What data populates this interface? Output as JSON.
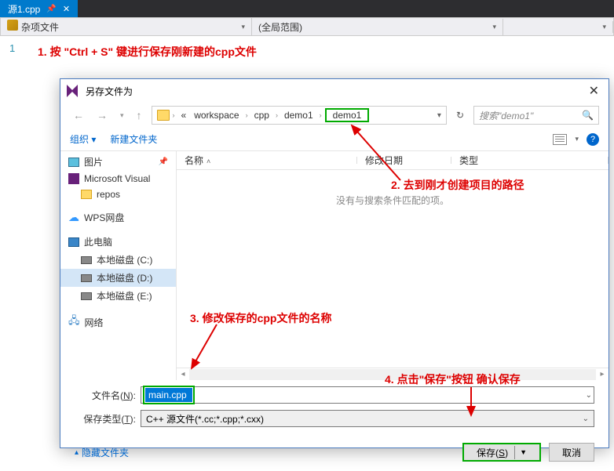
{
  "editor": {
    "tab_name": "源1.cpp",
    "misc_dropdown": "杂项文件",
    "scope_dropdown": "(全局范围)",
    "line_no": "1"
  },
  "annotations": {
    "a1": "1. 按 \"Ctrl + S\" 键进行保存刚新建的cpp文件",
    "a2": "2. 去到刚才创建项目的路径",
    "a3": "3. 修改保存的cpp文件的名称",
    "a4": "4. 点击\"保存\"按钮 确认保存"
  },
  "dialog": {
    "title": "另存文件为",
    "breadcrumb": {
      "prefix": "«",
      "items": [
        "workspace",
        "cpp",
        "demo1",
        "demo1"
      ]
    },
    "search_placeholder": "搜索\"demo1\"",
    "toolbar": {
      "organize": "组织",
      "newfolder": "新建文件夹"
    },
    "columns": {
      "name": "名称",
      "date": "修改日期",
      "type": "类型"
    },
    "empty_msg": "没有与搜索条件匹配的项。",
    "sidebar": {
      "pictures": "图片",
      "msvs": "Microsoft Visual",
      "repos": "repos",
      "wps": "WPS网盘",
      "thispc": "此电脑",
      "drive_c": "本地磁盘 (C:)",
      "drive_d": "本地磁盘 (D:)",
      "drive_e": "本地磁盘 (E:)",
      "network": "网络"
    },
    "form": {
      "fname_label_pre": "文件名(",
      "fname_label_u": "N",
      "fname_label_post": "):",
      "fname_value": "main.cpp",
      "type_label_pre": "保存类型(",
      "type_label_u": "T",
      "type_label_post": "):",
      "type_value": "C++ 源文件(*.cc;*.cpp;*.cxx)"
    },
    "footer": {
      "hide": "隐藏文件夹",
      "save_pre": "保存(",
      "save_u": "S",
      "save_post": ")",
      "cancel": "取消"
    },
    "help": "?"
  }
}
